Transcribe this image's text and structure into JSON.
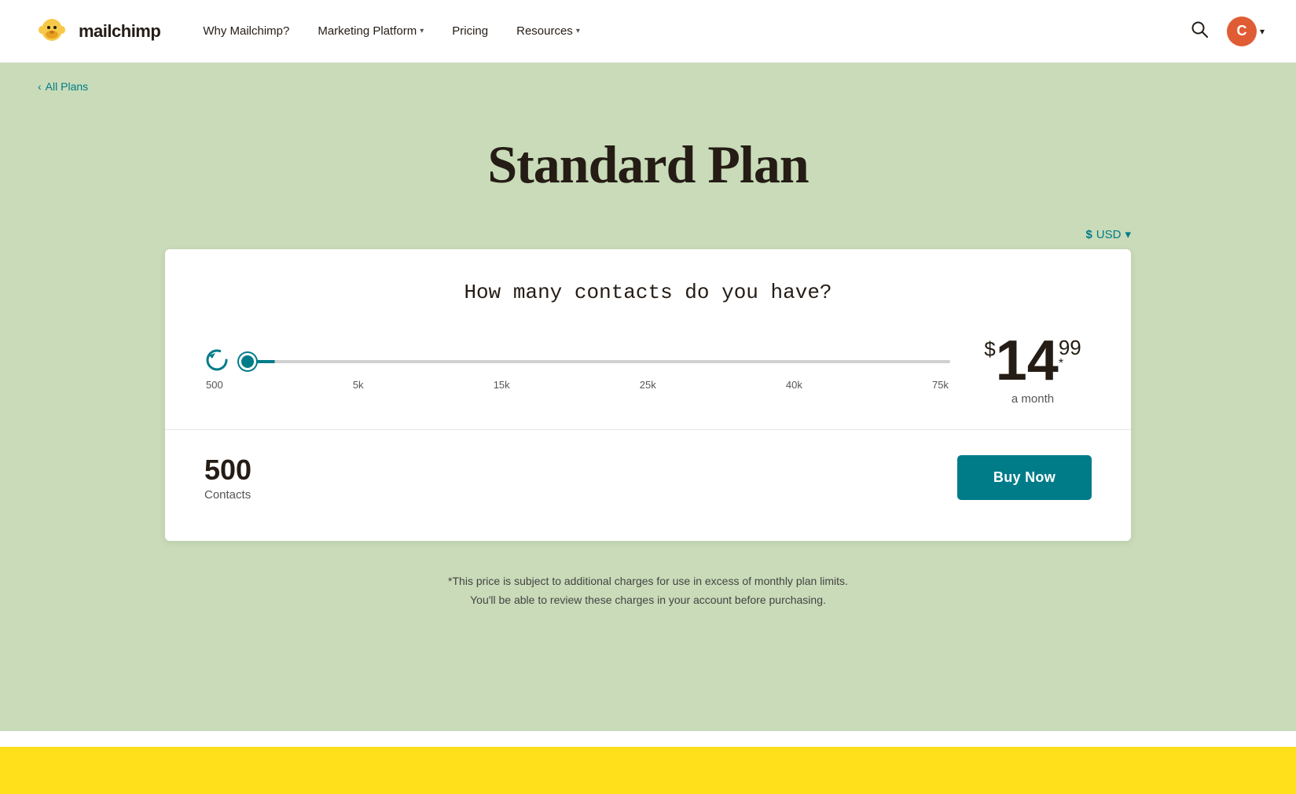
{
  "navbar": {
    "logo_text": "mailchimp",
    "nav_items": [
      {
        "label": "Why Mailchimp?",
        "has_dropdown": false
      },
      {
        "label": "Marketing Platform",
        "has_dropdown": true
      },
      {
        "label": "Pricing",
        "has_dropdown": false
      },
      {
        "label": "Resources",
        "has_dropdown": true
      }
    ],
    "search_icon_label": "search",
    "avatar_letter": "C",
    "avatar_chevron": "▾"
  },
  "breadcrumb": {
    "label": "All Plans",
    "arrow": "‹"
  },
  "page": {
    "title": "Standard Plan"
  },
  "currency": {
    "symbol": "$",
    "label": "USD",
    "chevron": "▾"
  },
  "pricing_card": {
    "question": "How many contacts do you have?",
    "slider": {
      "min": 0,
      "max": 100,
      "value": 0,
      "labels": [
        "500",
        "5k",
        "15k",
        "25k",
        "40k",
        "75k"
      ]
    },
    "price": {
      "dollar_sign": "$",
      "integer": "14",
      "decimal": "99",
      "asterisk": "*",
      "period": "a month"
    },
    "contacts_count": "500",
    "contacts_label": "Contacts",
    "buy_now_label": "Buy Now"
  },
  "footnote": {
    "line1": "*This price is subject to additional charges for use in excess of monthly plan limits.",
    "line2": "You'll be able to review these charges in your account before purchasing."
  },
  "bottom_bar": {}
}
